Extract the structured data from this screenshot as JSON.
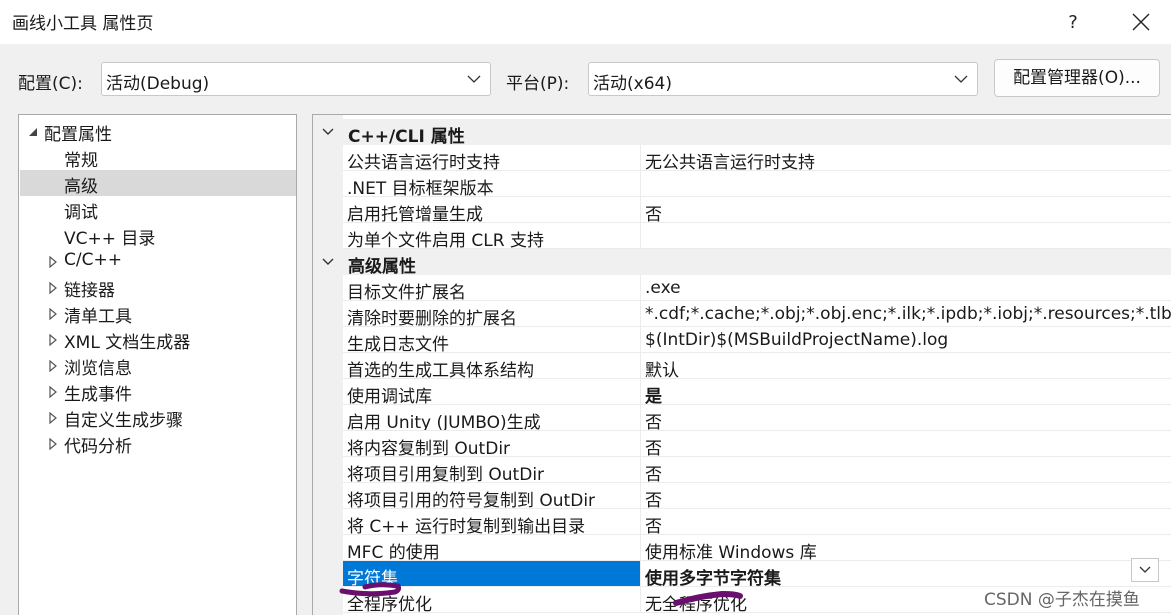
{
  "window": {
    "title": "画线小工具 属性页",
    "help_label": "?"
  },
  "toolbar": {
    "config_label": "配置(C):",
    "config_value": "活动(Debug)",
    "platform_label": "平台(P):",
    "platform_value": "活动(x64)",
    "manager_button": "配置管理器(O)..."
  },
  "tree": {
    "items": [
      {
        "label": "配置属性",
        "expander": "expanded"
      },
      {
        "label": "常规",
        "expander": "none"
      },
      {
        "label": "高级",
        "expander": "none",
        "selected": true
      },
      {
        "label": "调试",
        "expander": "none"
      },
      {
        "label": "VC++ 目录",
        "expander": "none"
      },
      {
        "label": "C/C++",
        "expander": "collapsed"
      },
      {
        "label": "链接器",
        "expander": "collapsed"
      },
      {
        "label": "清单工具",
        "expander": "collapsed"
      },
      {
        "label": "XML 文档生成器",
        "expander": "collapsed"
      },
      {
        "label": "浏览信息",
        "expander": "collapsed"
      },
      {
        "label": "生成事件",
        "expander": "collapsed"
      },
      {
        "label": "自定义生成步骤",
        "expander": "collapsed"
      },
      {
        "label": "代码分析",
        "expander": "collapsed"
      }
    ]
  },
  "grid": {
    "sections": [
      {
        "title": "C++/CLI 属性",
        "rows": [
          {
            "name": "公共语言运行时支持",
            "value": "无公共语言运行时支持"
          },
          {
            "name": ".NET 目标框架版本",
            "value": ""
          },
          {
            "name": "启用托管增量生成",
            "value": "否"
          },
          {
            "name": "为单个文件启用 CLR 支持",
            "value": ""
          }
        ]
      },
      {
        "title": "高级属性",
        "rows": [
          {
            "name": "目标文件扩展名",
            "value": ".exe"
          },
          {
            "name": "清除时要删除的扩展名",
            "value": "*.cdf;*.cache;*.obj;*.obj.enc;*.ilk;*.ipdb;*.iobj;*.resources;*.tlb;*.tli;*.tlh"
          },
          {
            "name": "生成日志文件",
            "value": "$(IntDir)$(MSBuildProjectName).log"
          },
          {
            "name": "首选的生成工具体系结构",
            "value": "默认"
          },
          {
            "name": "使用调试库",
            "value": "是",
            "bold": true
          },
          {
            "name": "启用 Unity (JUMBO)生成",
            "value": "否"
          },
          {
            "name": "将内容复制到 OutDir",
            "value": "否"
          },
          {
            "name": "将项目引用复制到 OutDir",
            "value": "否"
          },
          {
            "name": "将项目引用的符号复制到 OutDir",
            "value": "否"
          },
          {
            "name": "将 C++ 运行时复制到输出目录",
            "value": "否"
          },
          {
            "name": "MFC 的使用",
            "value": "使用标准 Windows 库"
          },
          {
            "name": "字符集",
            "value": "使用多字节字符集",
            "bold": true,
            "selected": true
          },
          {
            "name": "全程序优化",
            "value": "无全程序优化"
          }
        ]
      }
    ]
  },
  "watermark": "CSDN @子杰在摸鱼",
  "colors": {
    "selection": "#0078d7",
    "annotation_scribble": "#6a0f6e"
  }
}
